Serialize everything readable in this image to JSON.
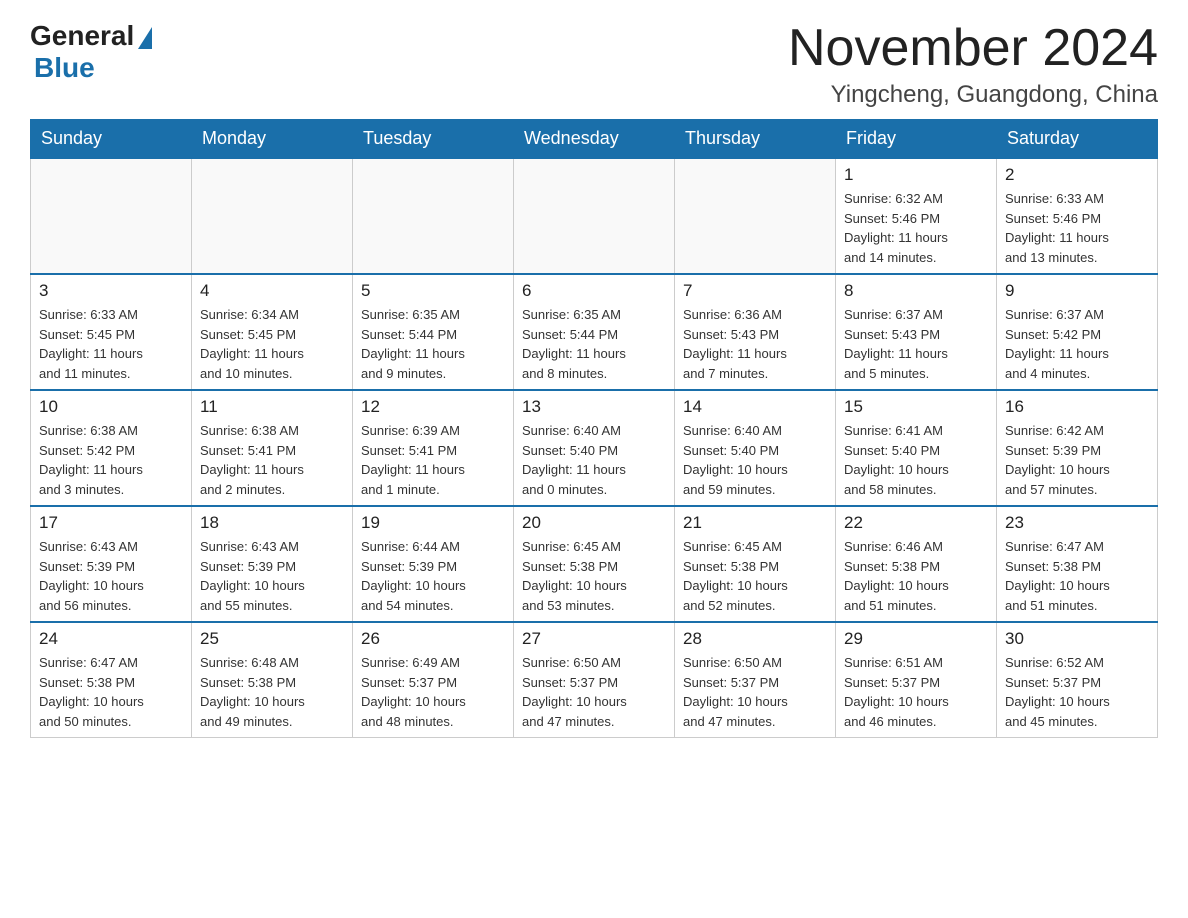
{
  "header": {
    "logo_general": "General",
    "logo_blue": "Blue",
    "month_title": "November 2024",
    "location": "Yingcheng, Guangdong, China"
  },
  "weekdays": [
    "Sunday",
    "Monday",
    "Tuesday",
    "Wednesday",
    "Thursday",
    "Friday",
    "Saturday"
  ],
  "weeks": [
    [
      {
        "day": "",
        "info": ""
      },
      {
        "day": "",
        "info": ""
      },
      {
        "day": "",
        "info": ""
      },
      {
        "day": "",
        "info": ""
      },
      {
        "day": "",
        "info": ""
      },
      {
        "day": "1",
        "info": "Sunrise: 6:32 AM\nSunset: 5:46 PM\nDaylight: 11 hours\nand 14 minutes."
      },
      {
        "day": "2",
        "info": "Sunrise: 6:33 AM\nSunset: 5:46 PM\nDaylight: 11 hours\nand 13 minutes."
      }
    ],
    [
      {
        "day": "3",
        "info": "Sunrise: 6:33 AM\nSunset: 5:45 PM\nDaylight: 11 hours\nand 11 minutes."
      },
      {
        "day": "4",
        "info": "Sunrise: 6:34 AM\nSunset: 5:45 PM\nDaylight: 11 hours\nand 10 minutes."
      },
      {
        "day": "5",
        "info": "Sunrise: 6:35 AM\nSunset: 5:44 PM\nDaylight: 11 hours\nand 9 minutes."
      },
      {
        "day": "6",
        "info": "Sunrise: 6:35 AM\nSunset: 5:44 PM\nDaylight: 11 hours\nand 8 minutes."
      },
      {
        "day": "7",
        "info": "Sunrise: 6:36 AM\nSunset: 5:43 PM\nDaylight: 11 hours\nand 7 minutes."
      },
      {
        "day": "8",
        "info": "Sunrise: 6:37 AM\nSunset: 5:43 PM\nDaylight: 11 hours\nand 5 minutes."
      },
      {
        "day": "9",
        "info": "Sunrise: 6:37 AM\nSunset: 5:42 PM\nDaylight: 11 hours\nand 4 minutes."
      }
    ],
    [
      {
        "day": "10",
        "info": "Sunrise: 6:38 AM\nSunset: 5:42 PM\nDaylight: 11 hours\nand 3 minutes."
      },
      {
        "day": "11",
        "info": "Sunrise: 6:38 AM\nSunset: 5:41 PM\nDaylight: 11 hours\nand 2 minutes."
      },
      {
        "day": "12",
        "info": "Sunrise: 6:39 AM\nSunset: 5:41 PM\nDaylight: 11 hours\nand 1 minute."
      },
      {
        "day": "13",
        "info": "Sunrise: 6:40 AM\nSunset: 5:40 PM\nDaylight: 11 hours\nand 0 minutes."
      },
      {
        "day": "14",
        "info": "Sunrise: 6:40 AM\nSunset: 5:40 PM\nDaylight: 10 hours\nand 59 minutes."
      },
      {
        "day": "15",
        "info": "Sunrise: 6:41 AM\nSunset: 5:40 PM\nDaylight: 10 hours\nand 58 minutes."
      },
      {
        "day": "16",
        "info": "Sunrise: 6:42 AM\nSunset: 5:39 PM\nDaylight: 10 hours\nand 57 minutes."
      }
    ],
    [
      {
        "day": "17",
        "info": "Sunrise: 6:43 AM\nSunset: 5:39 PM\nDaylight: 10 hours\nand 56 minutes."
      },
      {
        "day": "18",
        "info": "Sunrise: 6:43 AM\nSunset: 5:39 PM\nDaylight: 10 hours\nand 55 minutes."
      },
      {
        "day": "19",
        "info": "Sunrise: 6:44 AM\nSunset: 5:39 PM\nDaylight: 10 hours\nand 54 minutes."
      },
      {
        "day": "20",
        "info": "Sunrise: 6:45 AM\nSunset: 5:38 PM\nDaylight: 10 hours\nand 53 minutes."
      },
      {
        "day": "21",
        "info": "Sunrise: 6:45 AM\nSunset: 5:38 PM\nDaylight: 10 hours\nand 52 minutes."
      },
      {
        "day": "22",
        "info": "Sunrise: 6:46 AM\nSunset: 5:38 PM\nDaylight: 10 hours\nand 51 minutes."
      },
      {
        "day": "23",
        "info": "Sunrise: 6:47 AM\nSunset: 5:38 PM\nDaylight: 10 hours\nand 51 minutes."
      }
    ],
    [
      {
        "day": "24",
        "info": "Sunrise: 6:47 AM\nSunset: 5:38 PM\nDaylight: 10 hours\nand 50 minutes."
      },
      {
        "day": "25",
        "info": "Sunrise: 6:48 AM\nSunset: 5:38 PM\nDaylight: 10 hours\nand 49 minutes."
      },
      {
        "day": "26",
        "info": "Sunrise: 6:49 AM\nSunset: 5:37 PM\nDaylight: 10 hours\nand 48 minutes."
      },
      {
        "day": "27",
        "info": "Sunrise: 6:50 AM\nSunset: 5:37 PM\nDaylight: 10 hours\nand 47 minutes."
      },
      {
        "day": "28",
        "info": "Sunrise: 6:50 AM\nSunset: 5:37 PM\nDaylight: 10 hours\nand 47 minutes."
      },
      {
        "day": "29",
        "info": "Sunrise: 6:51 AM\nSunset: 5:37 PM\nDaylight: 10 hours\nand 46 minutes."
      },
      {
        "day": "30",
        "info": "Sunrise: 6:52 AM\nSunset: 5:37 PM\nDaylight: 10 hours\nand 45 minutes."
      }
    ]
  ]
}
